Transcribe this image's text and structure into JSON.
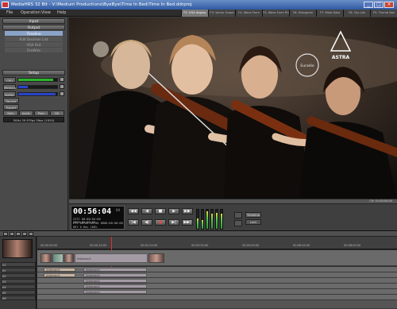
{
  "window": {
    "title": "MediaHRS 32 Bit - V:\\Medium Productions\\ByeBye\\Time In Bed\\Time In Bed.ddrproj"
  },
  "menu": [
    "File",
    "Operation",
    "View",
    "Help"
  ],
  "tabs": [
    {
      "label": "F2: VGA display",
      "active": true
    },
    {
      "label": "F3: Vector Scope",
      "active": false
    },
    {
      "label": "F4: Wave Form",
      "active": false
    },
    {
      "label": "F5: Wave Form RGB",
      "active": false
    },
    {
      "label": "F6: Histogram",
      "active": false
    },
    {
      "label": "F7: Meta Data",
      "active": false
    },
    {
      "label": "F8: Clip List",
      "active": false
    },
    {
      "label": "F9: Thumb Nail",
      "active": false
    }
  ],
  "left_panel": {
    "input_label": "Input",
    "output_label": "Output",
    "output_items": [
      {
        "label": "Timeline",
        "selected": true
      },
      {
        "label": "Edit Decision List",
        "selected": false
      },
      {
        "label": "VGA Out",
        "selected": false
      },
      {
        "label": "FireWire",
        "selected": false
      }
    ],
    "setup_label": "Setup",
    "meters": [
      {
        "label": "CPU",
        "level": 0.9,
        "color": "#2bb52b"
      },
      {
        "label": "Memory",
        "level": 0.25,
        "color": "#2a44c8"
      },
      {
        "label": "Buffer",
        "level": 0.95,
        "color": "#2a44c8"
      }
    ],
    "source_label": "Source",
    "export_label": "Export",
    "small_buttons": [
      "VidIn",
      "AudIn",
      "PlaIn",
      "Dtl"
    ],
    "info": "50Hz 29.97fps 59ps (1920)"
  },
  "video": {
    "overlay_logo": "ASTRA",
    "stamp_text": "Euradio"
  },
  "transport": {
    "timecode": "00:56:04",
    "frames": "04",
    "tc_lines": [
      "VITC  00:00:04:00        0000:00:00:00",
      "LTC   00:00:04:00        0000:00:00:00",
      "KEY   0          Rev 100%"
    ],
    "buttons": [
      "◀◀",
      "◀",
      "■",
      "▶",
      "▶▶",
      "|◀",
      "◀|",
      "●",
      "▶|",
      "▶▶|"
    ],
    "vu_levels": [
      0.55,
      0.45,
      0.9,
      0.8,
      0.85,
      0.8
    ],
    "dropdown": "Timeline",
    "dropdown2": "Lock",
    "status_right": "CH: 01:00:00:00 "
  },
  "timeline": {
    "ruler_ticks": [
      "00:00:00:00",
      "00:00:10:00",
      "00:01:24:00",
      "00:03:30:00",
      "00:05:00:00",
      "00:06:44:00",
      "00:08:00:00"
    ],
    "tracks": [
      {
        "label": "V1"
      },
      {
        "label": "A1"
      },
      {
        "label": "A2"
      },
      {
        "label": "A3"
      },
      {
        "label": "A4"
      },
      {
        "label": "A5"
      },
      {
        "label": "A6"
      }
    ],
    "clip_label": "Unbenannt"
  }
}
